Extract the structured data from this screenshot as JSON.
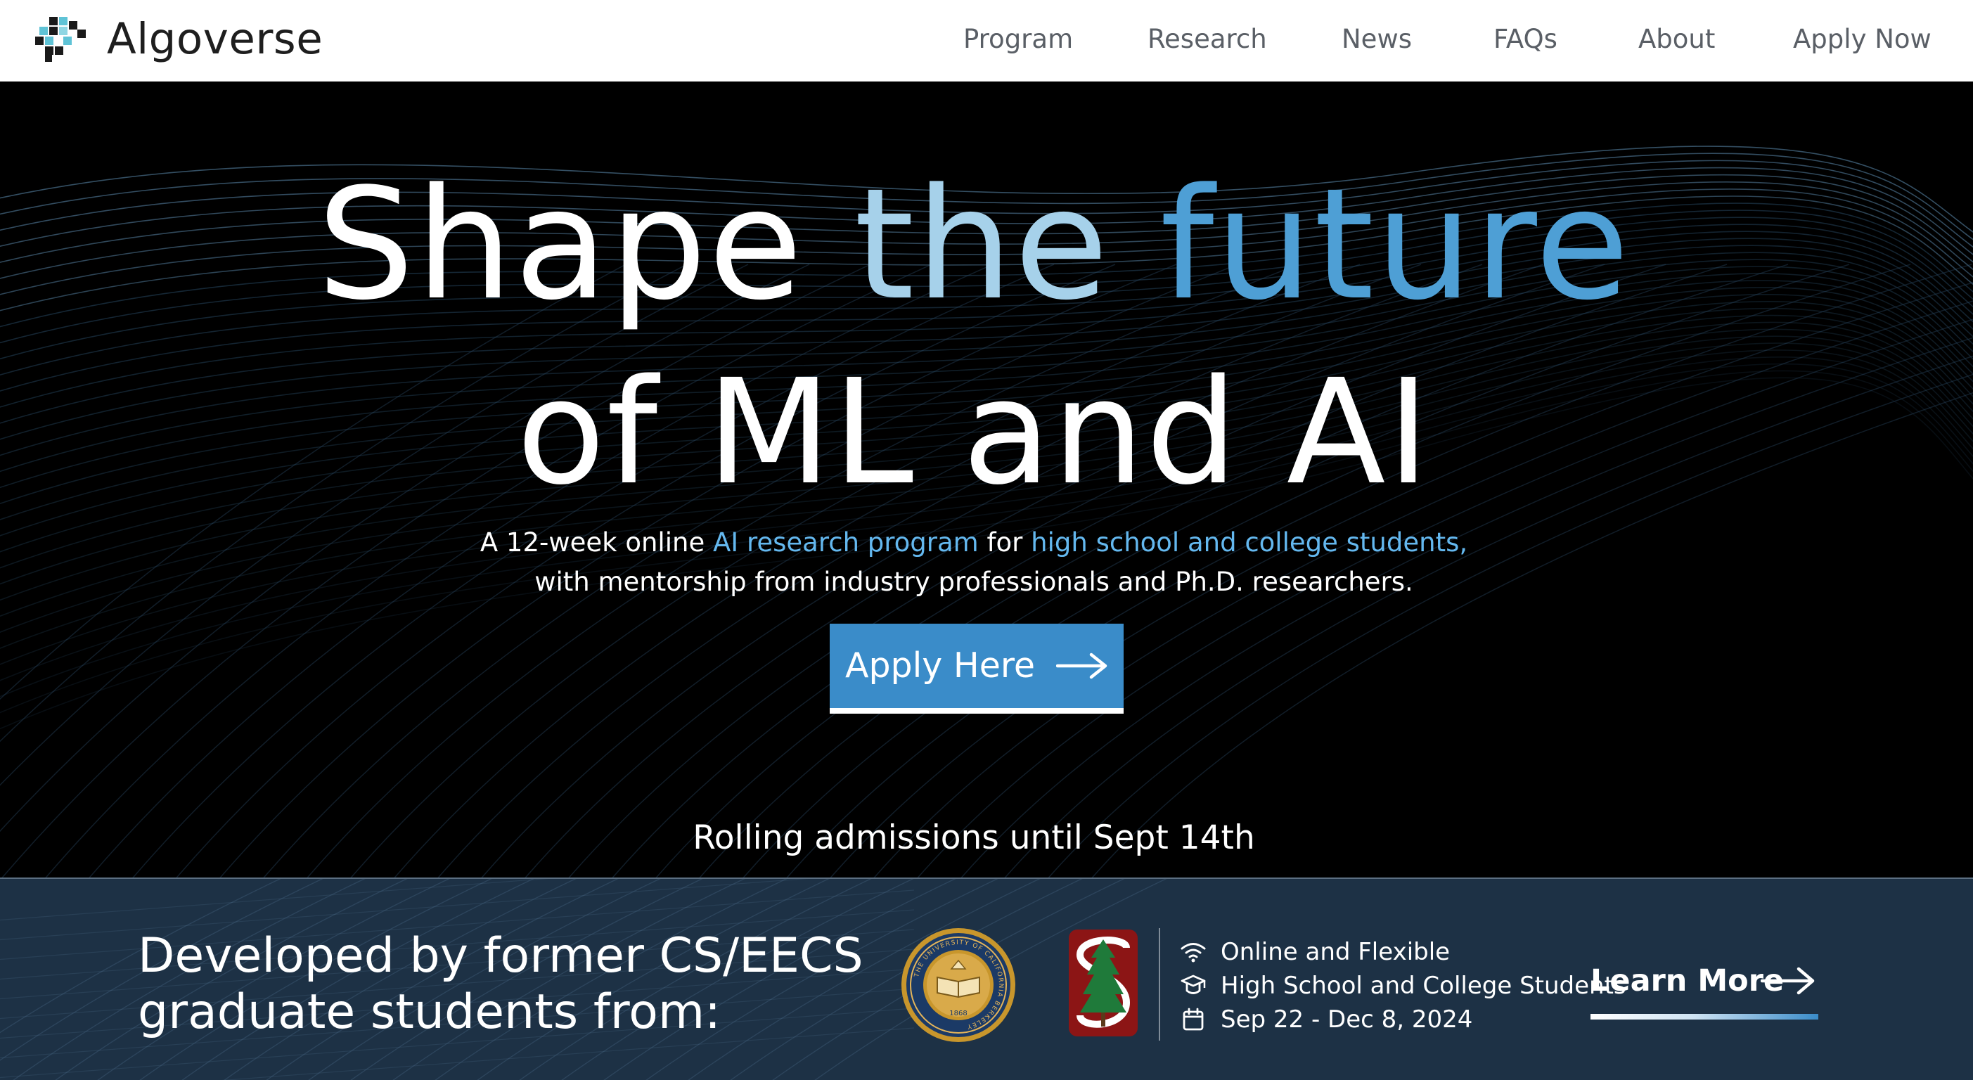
{
  "nav": {
    "brand": "Algoverse",
    "links": [
      "Program",
      "Research",
      "News",
      "FAQs",
      "About",
      "Apply Now"
    ]
  },
  "hero": {
    "headline": {
      "line1": [
        "Shape",
        "the",
        "future"
      ],
      "line2": "of ML and AI"
    },
    "subtitle": {
      "part1": "A 12-week online",
      "link1": "AI research program",
      "part2": "for",
      "link2": "high school and college students,",
      "line2": "with mentorship from industry professionals and Ph.D. researchers."
    },
    "cta": {
      "label": "Apply Here",
      "icon": "arrow-right-icon"
    },
    "note": "Rolling admissions until Sept 14th"
  },
  "band": {
    "title_line1": "Developed by former CS/EECS",
    "title_line2": "graduate students from:",
    "logos": [
      "uc-berkeley-seal",
      "stanford-logo"
    ],
    "seal_text": {
      "ring": "THE UNIVERSITY OF CALIFORNIA BERKELEY",
      "year": "1868"
    },
    "info": [
      {
        "icon": "wifi-icon",
        "text": "Online and Flexible"
      },
      {
        "icon": "graduation-cap-icon",
        "text": "High School and College Students"
      },
      {
        "icon": "calendar-icon",
        "text": "Sep 22 - Dec 8, 2024"
      }
    ],
    "learn_more": {
      "label": "Learn More",
      "icon": "arrow-right-icon"
    }
  },
  "colors": {
    "accent": "#3a8cc9",
    "headline_light": "#a6d1ea",
    "headline_blue": "#4e9fd5",
    "link_blue": "#64b8ef",
    "band_bg": "#1d3145"
  }
}
